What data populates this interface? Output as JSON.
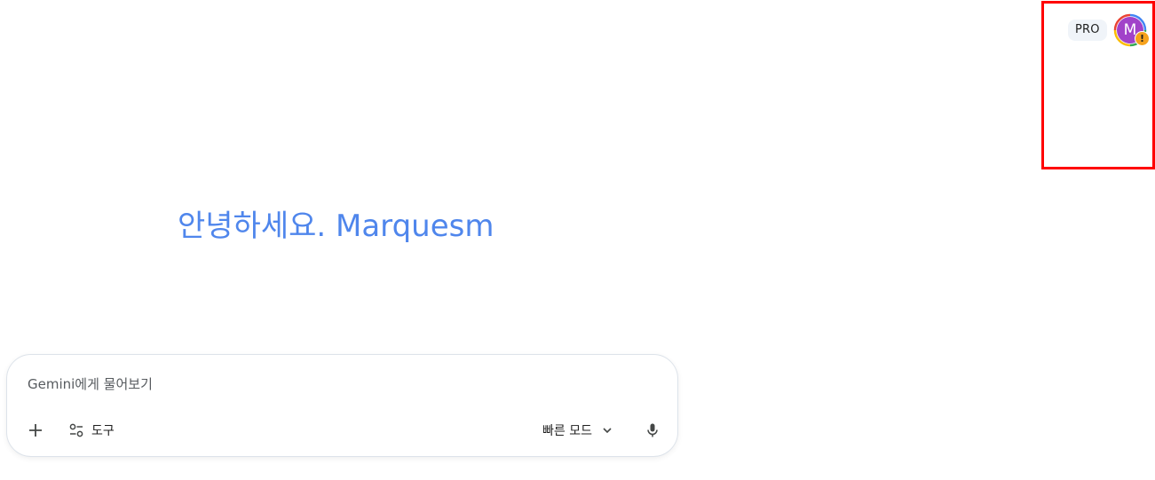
{
  "header": {
    "pro_badge": "PRO",
    "avatar_initial": "M",
    "avatar_color": "#a142c9",
    "warning_glyph": "!",
    "warning_color": "#f6a21c"
  },
  "main": {
    "greeting": "안녕하세요. Marquesm",
    "greeting_color": "#4f86ec"
  },
  "composer": {
    "placeholder": "Gemini에게 물어보기",
    "value": "",
    "add_icon": "plus-icon",
    "tools_icon": "tune-icon",
    "tools_label": "도구",
    "mode_label": "빠른 모드",
    "mode_icon": "chevron-down-icon",
    "mic_icon": "microphone-icon"
  },
  "highlight_color": "#ff0000"
}
